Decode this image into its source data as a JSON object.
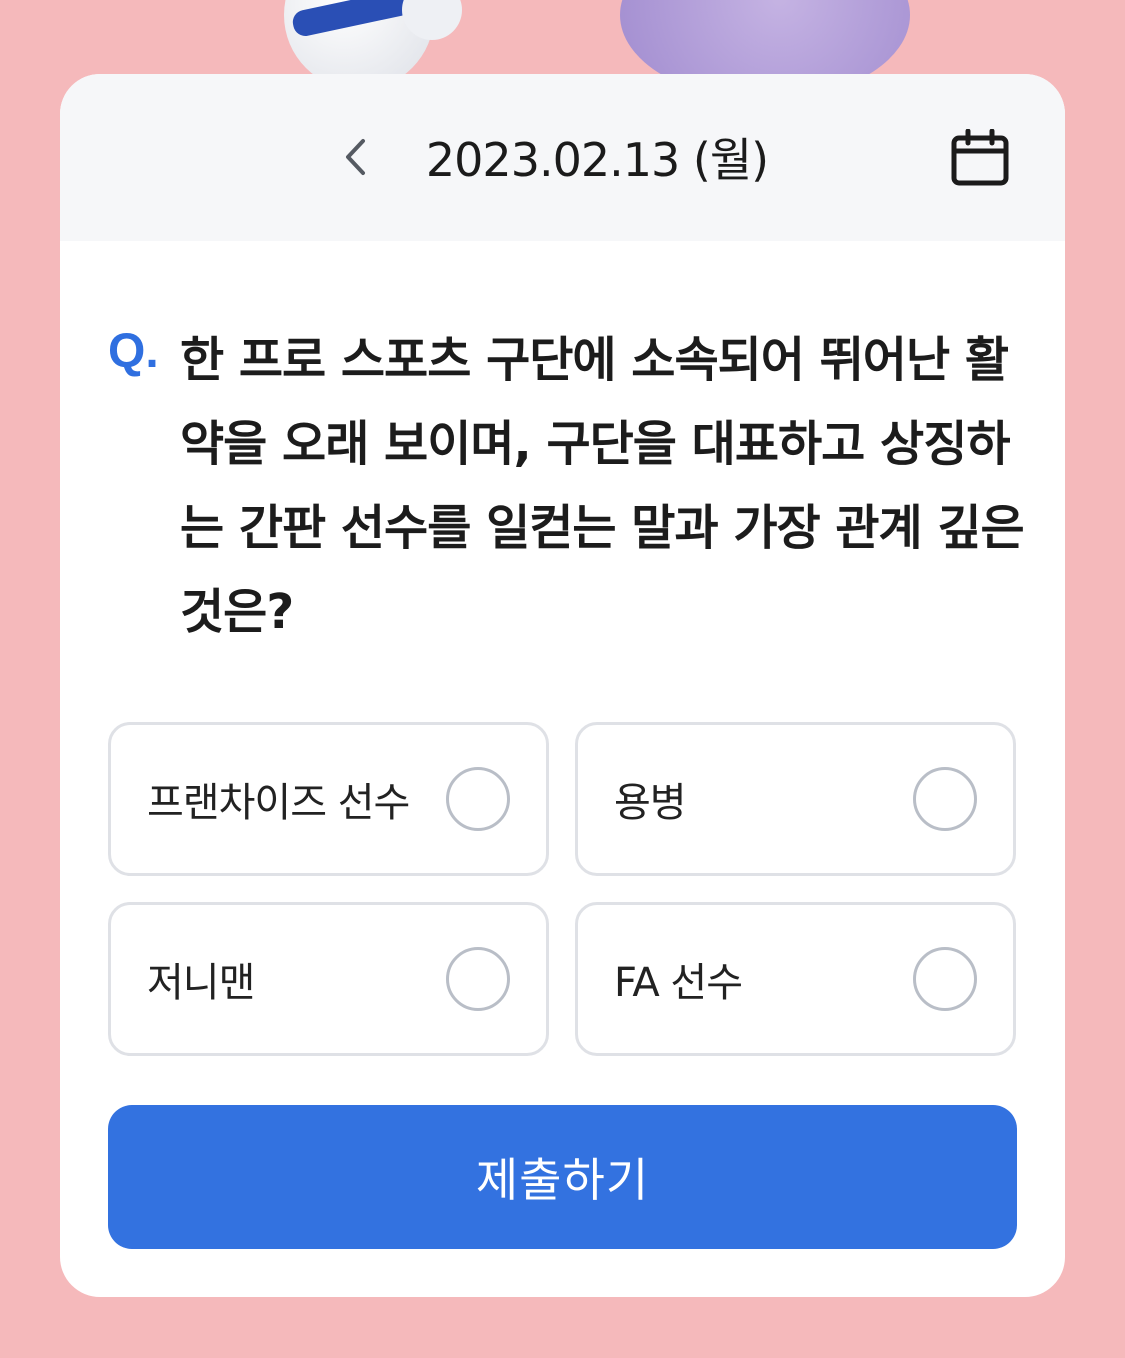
{
  "colors": {
    "background": "#f5b9bb",
    "accent": "#3372e0",
    "question_mark": "#2f6fe0",
    "header_bg": "#f6f7f9"
  },
  "header": {
    "date": "2023.02.13 (월)",
    "prev_icon": "chevron-left-icon",
    "calendar_icon": "calendar-icon"
  },
  "question": {
    "prefix": "Q.",
    "text": "한 프로 스포츠 구단에 소속되어 뛰어난 활약을 오래 보이며, 구단을 대표하고 상징하는 간판 선수를 일컫는 말과 가장 관계 깊은 것은?"
  },
  "options": [
    {
      "label": "프랜차이즈 선수",
      "selected": false
    },
    {
      "label": "용병",
      "selected": false
    },
    {
      "label": "저니맨",
      "selected": false
    },
    {
      "label": "FA 선수",
      "selected": false
    }
  ],
  "submit": {
    "label": "제출하기"
  }
}
